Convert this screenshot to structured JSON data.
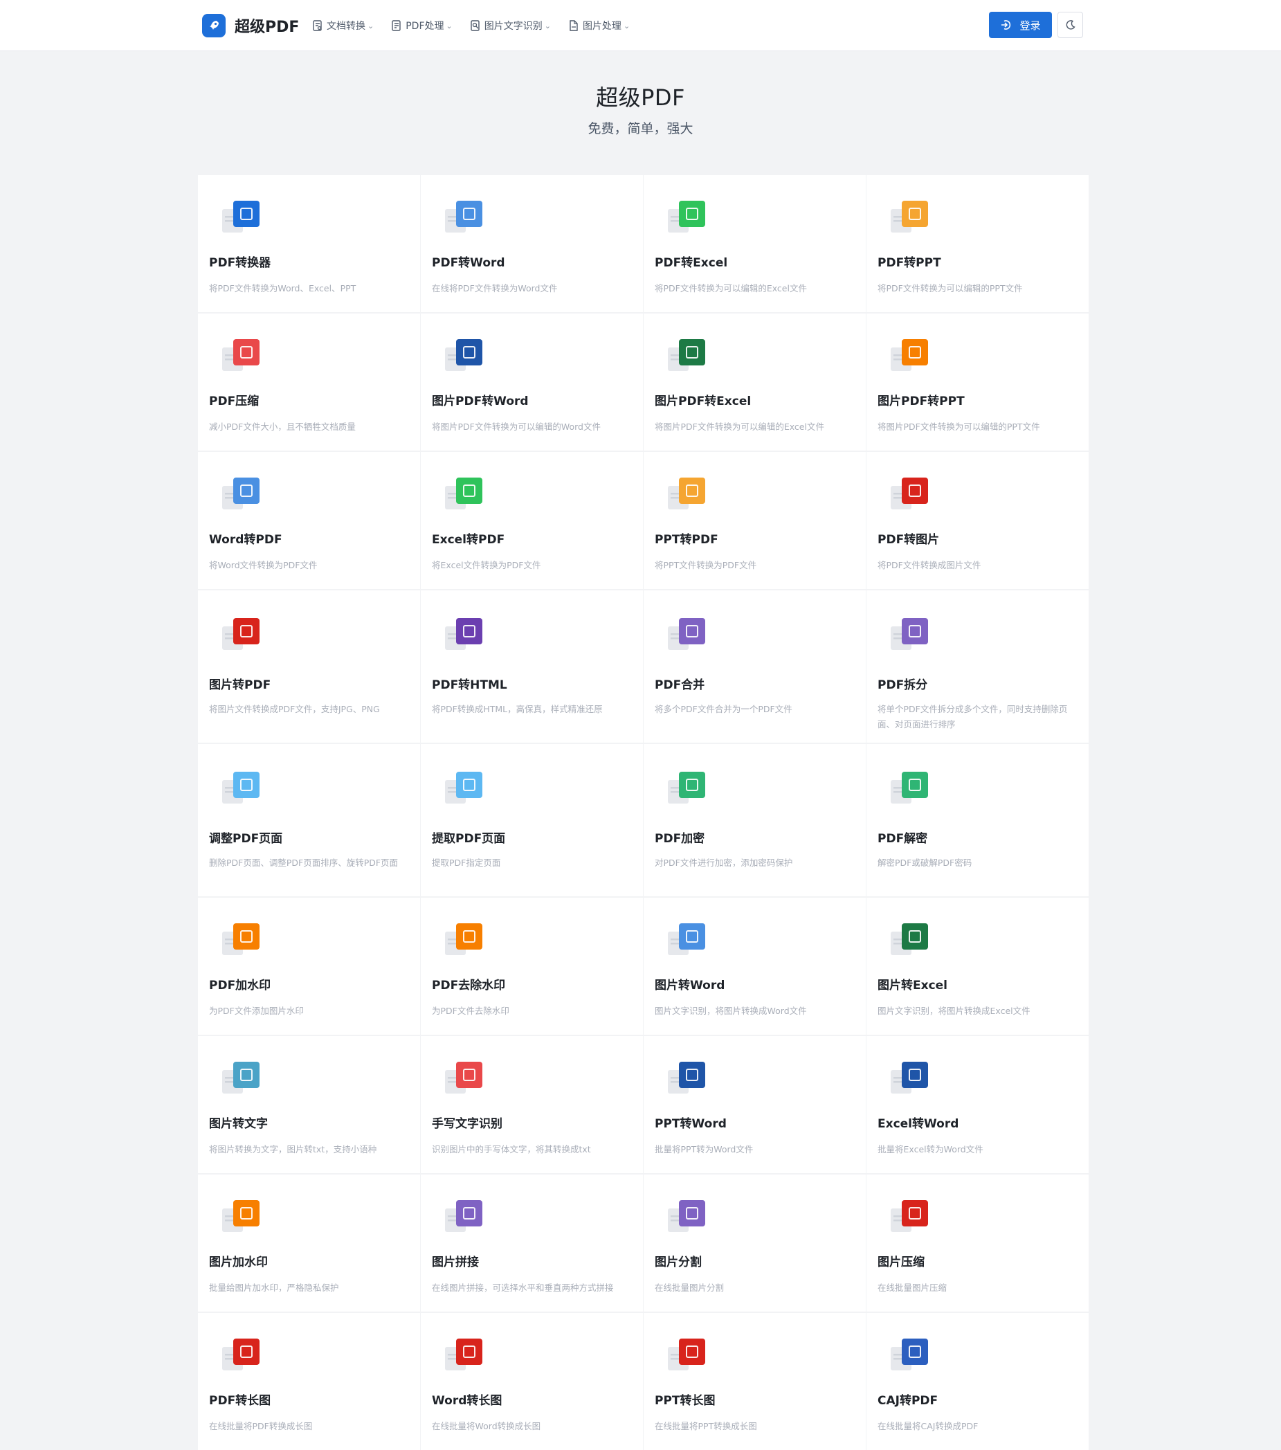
{
  "header": {
    "brand": "超级PDF",
    "nav": [
      {
        "label": "文档转换",
        "icon": "document-convert-icon"
      },
      {
        "label": "PDF处理",
        "icon": "pdf-process-icon"
      },
      {
        "label": "图片文字识别",
        "icon": "ocr-icon"
      },
      {
        "label": "图片处理",
        "icon": "image-process-icon"
      }
    ],
    "login_label": "登录"
  },
  "hero": {
    "title": "超级PDF",
    "subtitle": "免费，简单，强大"
  },
  "tools": [
    {
      "title": "PDF转换器",
      "desc": "将PDF文件转换为Word、Excel、PPT",
      "icon": "office-icon",
      "color": "#1e6fd9"
    },
    {
      "title": "PDF转Word",
      "desc": "在线将PDF文件转换为Word文件",
      "icon": "word-icon",
      "color": "#4a90e2"
    },
    {
      "title": "PDF转Excel",
      "desc": "将PDF文件转换为可以编辑的Excel文件",
      "icon": "excel-icon",
      "color": "#2fc35b"
    },
    {
      "title": "PDF转PPT",
      "desc": "将PDF文件转换为可以编辑的PPT文件",
      "icon": "ppt-icon",
      "color": "#f5a531"
    },
    {
      "title": "PDF压缩",
      "desc": "减小PDF文件大小，且不牺牲文档质量",
      "icon": "compress-icon",
      "color": "#e9484a"
    },
    {
      "title": "图片PDF转Word",
      "desc": "将图片PDF文件转换为可以编辑的Word文件",
      "icon": "word-icon",
      "color": "#1f55a8"
    },
    {
      "title": "图片PDF转Excel",
      "desc": "将图片PDF文件转换为可以编辑的Excel文件",
      "icon": "excel-icon",
      "color": "#1d7a45"
    },
    {
      "title": "图片PDF转PPT",
      "desc": "将图片PDF文件转换为可以编辑的PPT文件",
      "icon": "ppt-icon",
      "color": "#f77f00"
    },
    {
      "title": "Word转PDF",
      "desc": "将Word文件转换为PDF文件",
      "icon": "word-to-pdf-icon",
      "color": "#4a90e2"
    },
    {
      "title": "Excel转PDF",
      "desc": "将Excel文件转换为PDF文件",
      "icon": "excel-to-pdf-icon",
      "color": "#2fc35b"
    },
    {
      "title": "PPT转PDF",
      "desc": "将PPT文件转换为PDF文件",
      "icon": "ppt-to-pdf-icon",
      "color": "#f5a531"
    },
    {
      "title": "PDF转图片",
      "desc": "将PDF文件转换成图片文件",
      "icon": "pdf-to-image-icon",
      "color": "#d8241c"
    },
    {
      "title": "图片转PDF",
      "desc": "将图片文件转换成PDF文件，支持JPG、PNG",
      "icon": "image-to-pdf-icon",
      "color": "#d8241c"
    },
    {
      "title": "PDF转HTML",
      "desc": "将PDF转换成HTML，高保真，样式精准还原",
      "icon": "html-icon",
      "color": "#6b3fb0"
    },
    {
      "title": "PDF合并",
      "desc": "将多个PDF文件合并为一个PDF文件",
      "icon": "merge-icon",
      "color": "#7f62c3"
    },
    {
      "title": "PDF拆分",
      "desc": "将单个PDF文件拆分成多个文件，同时支持删除页面、对页面进行排序",
      "icon": "split-icon",
      "color": "#7f62c3"
    },
    {
      "title": "调整PDF页面",
      "desc": "删除PDF页面、调整PDF页面排序、旋转PDF页面",
      "icon": "adjust-pages-icon",
      "color": "#5db8f2"
    },
    {
      "title": "提取PDF页面",
      "desc": "提取PDF指定页面",
      "icon": "extract-pages-icon",
      "color": "#5db8f2"
    },
    {
      "title": "PDF加密",
      "desc": "对PDF文件进行加密，添加密码保护",
      "icon": "shield-lock-icon",
      "color": "#2fb574"
    },
    {
      "title": "PDF解密",
      "desc": "解密PDF或破解PDF密码",
      "icon": "unlock-icon",
      "color": "#2fb574"
    },
    {
      "title": "PDF加水印",
      "desc": "为PDF文件添加图片水印",
      "icon": "stamp-icon",
      "color": "#f77f00"
    },
    {
      "title": "PDF去除水印",
      "desc": "为PDF文件去除水印",
      "icon": "remove-watermark-icon",
      "color": "#f77f00"
    },
    {
      "title": "图片转Word",
      "desc": "图片文字识别，将图片转换成Word文件",
      "icon": "word-icon",
      "color": "#4a90e2"
    },
    {
      "title": "图片转Excel",
      "desc": "图片文字识别，将图片转换成Excel文件",
      "icon": "excel-icon",
      "color": "#1d7a45"
    },
    {
      "title": "图片转文字",
      "desc": "将图片转换为文字，图片转txt，支持小语种",
      "icon": "image-to-text-icon",
      "color": "#4ba3c7"
    },
    {
      "title": "手写文字识别",
      "desc": "识别图片中的手写体文字，将其转换成txt",
      "icon": "handwriting-icon",
      "color": "#e9484a"
    },
    {
      "title": "PPT转Word",
      "desc": "批量将PPT转为Word文件",
      "icon": "word-icon",
      "color": "#1f55a8"
    },
    {
      "title": "Excel转Word",
      "desc": "批量将Excel转为Word文件",
      "icon": "word-icon",
      "color": "#1f55a8"
    },
    {
      "title": "图片加水印",
      "desc": "批量给图片加水印，严格隐私保护",
      "icon": "stamp-icon",
      "color": "#f77f00"
    },
    {
      "title": "图片拼接",
      "desc": "在线图片拼接，可选择水平和垂直两种方式拼接",
      "icon": "image-join-icon",
      "color": "#7f62c3"
    },
    {
      "title": "图片分割",
      "desc": "在线批量图片分割",
      "icon": "image-split-icon",
      "color": "#7f62c3"
    },
    {
      "title": "图片压缩",
      "desc": "在线批量图片压缩",
      "icon": "image-compress-icon",
      "color": "#d8241c"
    },
    {
      "title": "PDF转长图",
      "desc": "在线批量将PDF转换成长图",
      "icon": "long-image-icon",
      "color": "#d8241c"
    },
    {
      "title": "Word转长图",
      "desc": "在线批量将Word转换成长图",
      "icon": "long-image-icon",
      "color": "#d8241c"
    },
    {
      "title": "PPT转长图",
      "desc": "在线批量将PPT转换成长图",
      "icon": "long-image-icon",
      "color": "#d8241c"
    },
    {
      "title": "CAJ转PDF",
      "desc": "在线批量将CAJ转换成PDF",
      "icon": "caj-to-pdf-icon",
      "color": "#2c5fbf"
    }
  ]
}
